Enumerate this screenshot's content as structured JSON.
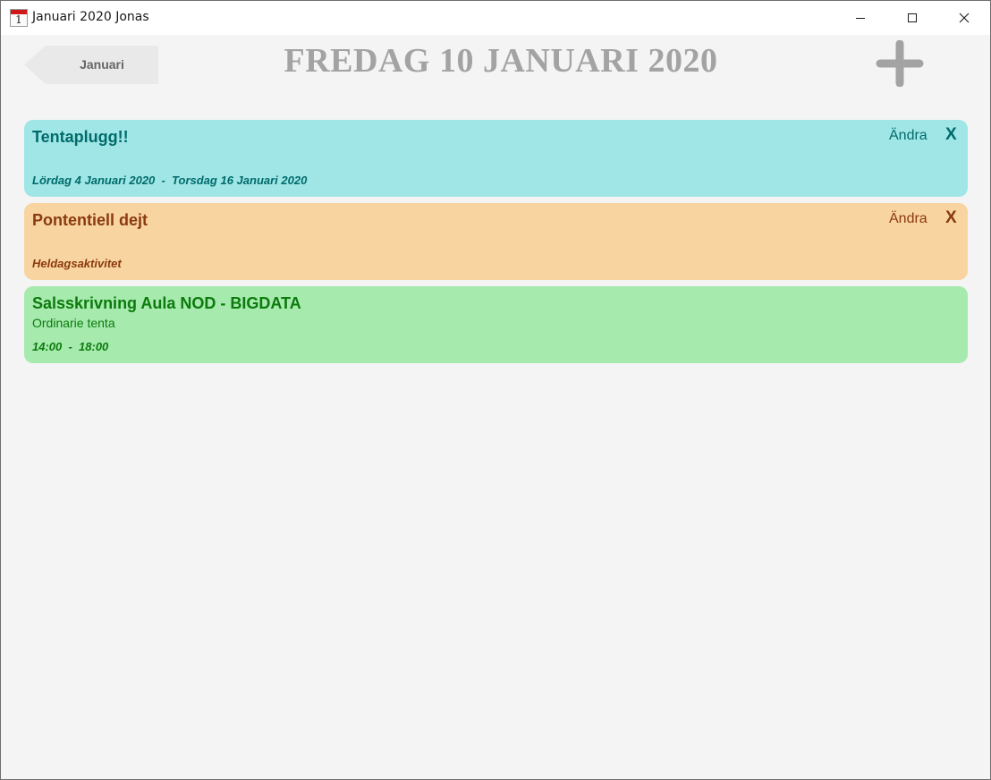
{
  "window": {
    "title": "Januari 2020 Jonas",
    "app_icon": {
      "name": "calendar-app-icon",
      "day": "1"
    },
    "caption_buttons": [
      "minimize-icon",
      "maximize-icon",
      "close-icon"
    ]
  },
  "header": {
    "back_label": "Januari",
    "title": "FREDAG 10 JANUARI 2020",
    "add_icon": "plus-icon"
  },
  "colors": {
    "title_gray": "#a3a3a3",
    "back_button_bg": "#e9e9e9"
  },
  "events": [
    {
      "title": "Tentaplugg!!",
      "description": "",
      "time": "Lördag 4 Januari 2020  -  Torsdag 16 Januari 2020",
      "edit_label": "Ändra",
      "delete_label": "X",
      "background": "#a0e6e6",
      "text_color": "#006b6b"
    },
    {
      "title": "Pontentiell dejt",
      "description": "",
      "time": "Heldagsaktivitet",
      "edit_label": "Ändra",
      "delete_label": "X",
      "background": "#f8d4a0",
      "text_color": "#8a3a0e"
    },
    {
      "title": "Salsskrivning Aula NOD - BIGDATA",
      "description": "Ordinarie tenta",
      "time": "14:00  -  18:00",
      "background": "#a6eaae",
      "text_color": "#0c7a0c"
    }
  ]
}
